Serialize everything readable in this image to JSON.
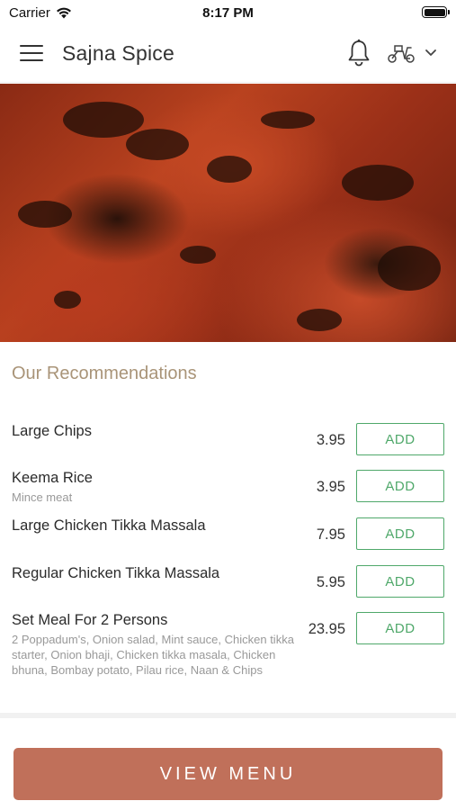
{
  "status_bar": {
    "carrier": "Carrier",
    "time": "8:17 PM"
  },
  "header": {
    "title": "Sajna Spice",
    "icons": [
      "menu-icon",
      "bell-icon",
      "scooter-icon",
      "chevron-down-icon"
    ]
  },
  "hero": {
    "image": "grilled-tandoori-chicken"
  },
  "recommendations": {
    "title": "Our Recommendations",
    "items": [
      {
        "name": "Large Chips",
        "description": "",
        "price": "3.95",
        "button": "ADD"
      },
      {
        "name": "Keema Rice",
        "description": "Mince meat",
        "price": "3.95",
        "button": "ADD"
      },
      {
        "name": "Large Chicken Tikka Massala",
        "description": "",
        "price": "7.95",
        "button": "ADD"
      },
      {
        "name": "Regular Chicken Tikka Massala",
        "description": "",
        "price": "5.95",
        "button": "ADD"
      },
      {
        "name": "Set Meal For 2 Persons",
        "description": "2 Poppadum's, Onion salad, Mint sauce, Chicken tikka starter, Onion bhaji, Chicken tikka masala, Chicken bhuna, Bombay potato, Pilau rice, Naan & Chips",
        "price": "23.95",
        "button": "ADD"
      }
    ]
  },
  "footer": {
    "view_menu_label": "VIEW MENU"
  },
  "colors": {
    "accent_gold": "#a99478",
    "add_green": "#4fa86a",
    "cta_terracotta": "#c0705a"
  }
}
